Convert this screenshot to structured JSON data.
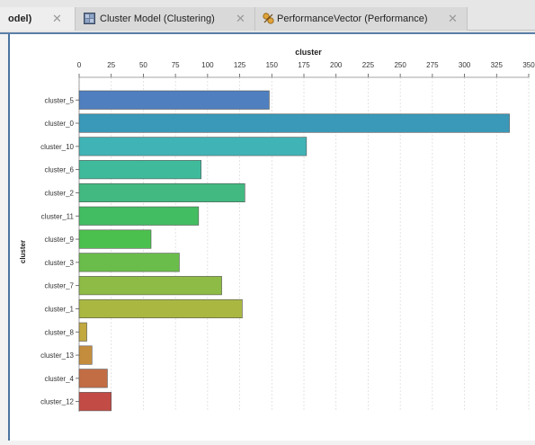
{
  "tabs": [
    {
      "label": "odel)",
      "close": "✕",
      "icon": "none"
    },
    {
      "label": "Cluster Model (Clustering)",
      "close": "✕",
      "icon": "cluster-model-icon"
    },
    {
      "label": "PerformanceVector (Performance)",
      "close": "✕",
      "icon": "performance-icon"
    }
  ],
  "colors": {
    "panel_border": "#4a72a0",
    "grid": "#d8d8d8"
  },
  "chart_data": {
    "type": "bar",
    "orientation": "horizontal",
    "title": "cluster",
    "xlabel": "cluster",
    "ylabel": "cluster",
    "xlim": [
      0,
      350
    ],
    "ticks": [
      0,
      25,
      50,
      75,
      100,
      125,
      150,
      175,
      200,
      225,
      250,
      275,
      300,
      325,
      350
    ],
    "categories": [
      "cluster_5",
      "cluster_0",
      "cluster_10",
      "cluster_6",
      "cluster_2",
      "cluster_11",
      "cluster_9",
      "cluster_3",
      "cluster_7",
      "cluster_1",
      "cluster_8",
      "cluster_13",
      "cluster_4",
      "cluster_12"
    ],
    "values": [
      148,
      335,
      177,
      95,
      129,
      93,
      56,
      78,
      111,
      127,
      6,
      10,
      22,
      25
    ],
    "colors": [
      "#4f7fbf",
      "#3a98b8",
      "#40b3b6",
      "#3fbb9c",
      "#41b981",
      "#43bd62",
      "#4cc04e",
      "#6abd4a",
      "#8ebb45",
      "#aab842",
      "#c1a83f",
      "#c48d3d",
      "#c26d44",
      "#c34b45"
    ],
    "grid": true
  }
}
